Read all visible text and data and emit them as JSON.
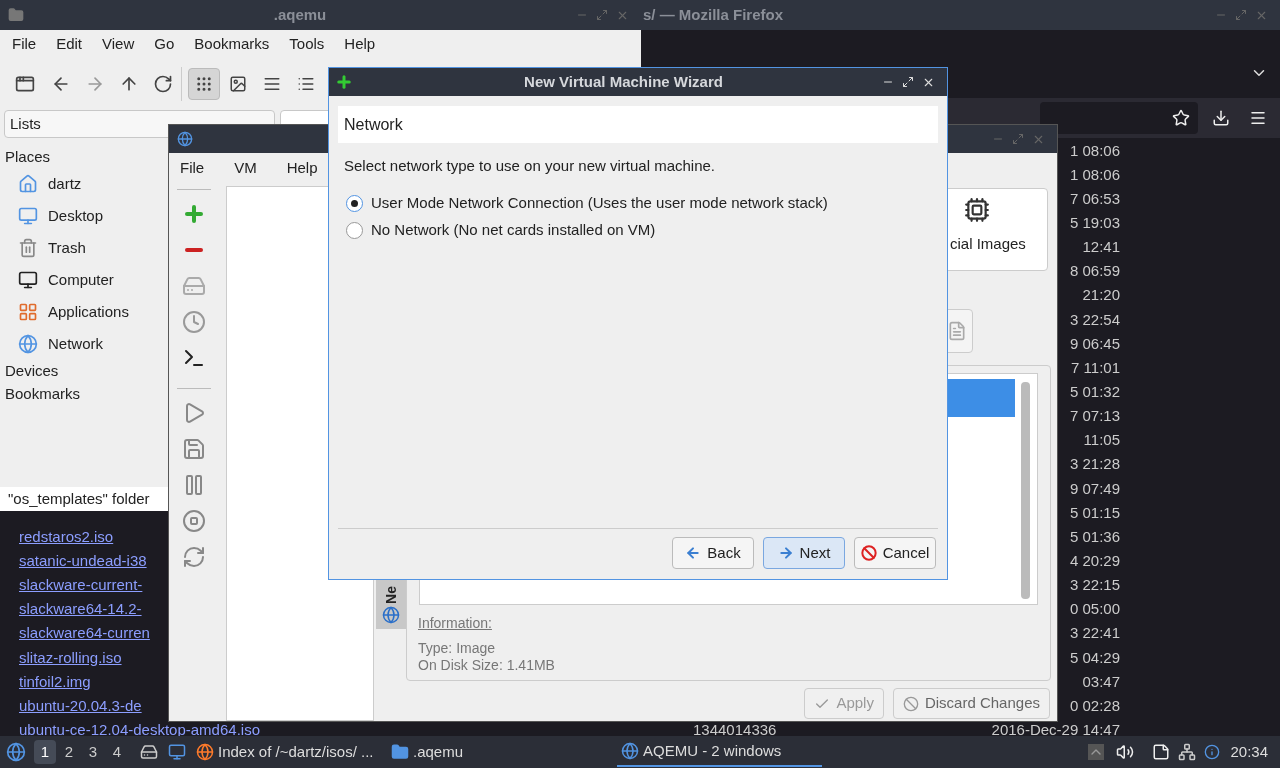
{
  "firefox": {
    "title": "s/ — Mozilla Firefox",
    "rows": [
      {
        "date": "1 08:06"
      },
      {
        "date": "1 08:06"
      },
      {
        "date": "7 06:53"
      },
      {
        "date": "5 19:03"
      },
      {
        "date": "12:41"
      },
      {
        "date": "8 06:59"
      },
      {
        "date": "21:20"
      },
      {
        "date": "3 22:54"
      },
      {
        "date": "9 06:45"
      },
      {
        "date": "7 11:01"
      },
      {
        "date": "5 01:32"
      },
      {
        "date": "7 07:13"
      },
      {
        "date": "11:05"
      },
      {
        "date": "3 21:28"
      },
      {
        "date": "9 07:49"
      },
      {
        "date": "5 01:15"
      },
      {
        "name": "redstaros2.iso",
        "date": "5 01:36"
      },
      {
        "name": "satanic-undead-i38",
        "date": "4 20:29"
      },
      {
        "name": "slackware-current-",
        "date": "3 22:15"
      },
      {
        "name": "slackware64-14.2-",
        "date": "0 05:00"
      },
      {
        "name": "slackware64-curren",
        "date": "3 22:41"
      },
      {
        "name": "slitaz-rolling.iso",
        "date": "5 04:29"
      },
      {
        "name": "tinfoil2.img",
        "date": "03:47"
      },
      {
        "name": "ubuntu-20.04.3-de",
        "date": "0 02:28"
      },
      {
        "name": "ubuntu-ce-12.04-desktop-amd64.iso",
        "size": "1344014336",
        "date": "2016-Dec-29 14:47"
      }
    ]
  },
  "file_manager": {
    "title": ".aqemu",
    "menu": [
      "File",
      "Edit",
      "View",
      "Go",
      "Bookmarks",
      "Tools",
      "Help"
    ],
    "view_buttons": [
      {
        "selected": true
      },
      {
        "selected": false
      },
      {
        "selected": false
      },
      {
        "selected": false
      }
    ],
    "panel_selector": "Lists",
    "places_heading": "Places",
    "places": [
      "dartz",
      "Desktop",
      "Trash",
      "Computer",
      "Applications",
      "Network"
    ],
    "headings": [
      "Devices",
      "Bookmarks"
    ],
    "status": "\"os_templates\" folder"
  },
  "aqemu": {
    "menu": [
      "File",
      "VM",
      "Help"
    ],
    "card_label": "cial Images",
    "side_tab": "Ne",
    "info_heading": "Information:",
    "info_lines": [
      "Type: Image",
      "On Disk Size: 1.41MB"
    ],
    "buttons": [
      {
        "label": "Apply",
        "disabled": true
      },
      {
        "label": "Discard Changes",
        "disabled": false
      }
    ]
  },
  "wizard": {
    "title": "New Virtual Machine Wizard",
    "page": "Network",
    "prompt": "Select network type to use on your new virtual machine.",
    "options": [
      {
        "label": "User Mode Network Connection (Uses the user mode network stack)",
        "selected": true
      },
      {
        "label": "No Network (No net cards installed on VM)",
        "selected": false
      }
    ],
    "buttons": [
      {
        "label": "Back",
        "default": false
      },
      {
        "label": "Next",
        "default": true
      },
      {
        "label": "Cancel",
        "default": false
      }
    ]
  },
  "taskbar": {
    "workspaces": [
      {
        "label": "1",
        "selected": true
      },
      {
        "label": "2",
        "selected": false
      },
      {
        "label": "3",
        "selected": false
      },
      {
        "label": "4",
        "selected": false
      }
    ],
    "tasks": [
      {
        "label": "Index of /~dartz/isos/ ...",
        "selected": false
      },
      {
        "label": ".aqemu",
        "selected": false
      },
      {
        "label": "AQEMU - 2 windows",
        "selected": true
      }
    ],
    "clock": "20:34"
  }
}
